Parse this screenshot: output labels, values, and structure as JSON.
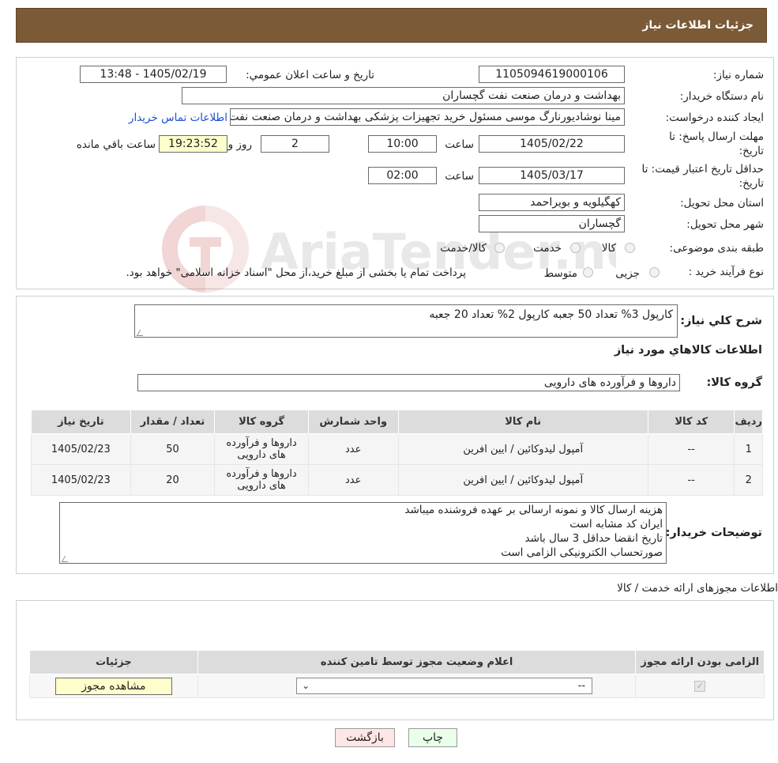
{
  "header": {
    "title": "جزئیات اطلاعات نیاز"
  },
  "form": {
    "need_number_label": "شماره نیاز:",
    "need_number": "1105094619000106",
    "announce_label": "تاریخ و ساعت اعلان عمومي:",
    "announce_value": "1405/02/19 - 13:48",
    "buyer_org_label": "نام دستگاه خريدار:",
    "buyer_org": "بهداشت و درمان صنعت نفت گچساران",
    "creator_label": "ایجاد کننده درخواست:",
    "creator": "مینا نوشادیورنارگ موسی مسئول خرید تجهیزات پزشکی  بهداشت و درمان صنعت نفت",
    "contact_link": "اطلاعات تماس خریدار",
    "deadline_label_1": "مهلت ارسال پاسخ: تا",
    "deadline_label_2": "تاریخ:",
    "deadline_date": "1405/02/22",
    "time_label": "ساعت",
    "deadline_time": "10:00",
    "days": "2",
    "days_label": "روز و",
    "remaining_time": "19:23:52",
    "remaining_label": "ساعت باقي مانده",
    "validity_label_1": "حداقل تاریخ اعتبار قیمت: تا",
    "validity_label_2": "تاریخ:",
    "validity_date": "1405/03/17",
    "validity_time": "02:00",
    "province_label": "استان محل تحویل:",
    "province": "کهگیلویه و بویراحمد",
    "city_label": "شهر محل تحویل:",
    "city": "گچساران",
    "category_label": "طبقه بندی موضوعی:",
    "category_options": [
      "کالا",
      "خدمت",
      "کالا/خدمت"
    ],
    "process_label": "نوع فرآیند خرید :",
    "process_options": [
      "جزیی",
      "متوسط"
    ],
    "process_note": "پرداخت تمام یا بخشی از مبلغ خرید،از محل \"اسناد خزانه اسلامی\" خواهد بود."
  },
  "watermark_text": "AriaTender.neT",
  "description": {
    "label": "شرح کلي نیاز:",
    "text": "کارپول 3% تعداد 50 جعبه کارپول 2% تعداد 20 جعبه"
  },
  "goods_info_title": "اطلاعات کالاهاي مورد نیاز",
  "goods_group": {
    "label": "گروه کالا:",
    "value": "داروها و فرآورده های دارویی"
  },
  "goods_table": {
    "headers": [
      "ردیف",
      "کد کالا",
      "نام کالا",
      "واحد شمارش",
      "گروه کالا",
      "تعداد / مقدار",
      "تاریخ نیاز"
    ],
    "rows": [
      [
        "1",
        "--",
        "آمپول لیدوکائین / ایین افرین",
        "عدد",
        "داروها و فرآورده های دارویی",
        "50",
        "1405/02/23"
      ],
      [
        "2",
        "--",
        "آمپول لیدوکائین / ایین افرین",
        "عدد",
        "داروها و فرآورده های دارویی",
        "20",
        "1405/02/23"
      ]
    ]
  },
  "buyer_notes": {
    "label": "توضیحات خریدار:",
    "lines": [
      "هزینه ارسال کالا و نمونه ارسالی بر عهده فروشنده میباشد",
      "ایران کد مشابه است",
      "تاریخ انقضا حداقل 3 سال باشد",
      "صورتحساب الکترونیکی الزامی است"
    ]
  },
  "permits": {
    "title": "اطلاعات مجوزهای ارائه خدمت / کالا",
    "headers": [
      "الزامی بودن ارائه مجوز",
      "اعلام وضعیت مجوز توسط تامین کننده",
      "جزئیات"
    ],
    "select_value": "--",
    "view_button": "مشاهده مجوز"
  },
  "buttons": {
    "print": "چاپ",
    "back": "بازگشت"
  },
  "colors": {
    "header_bg": "#7b5a37",
    "link": "#1a4fd6",
    "print_bg": "#eaffea",
    "back_bg": "#ffe6e6"
  }
}
